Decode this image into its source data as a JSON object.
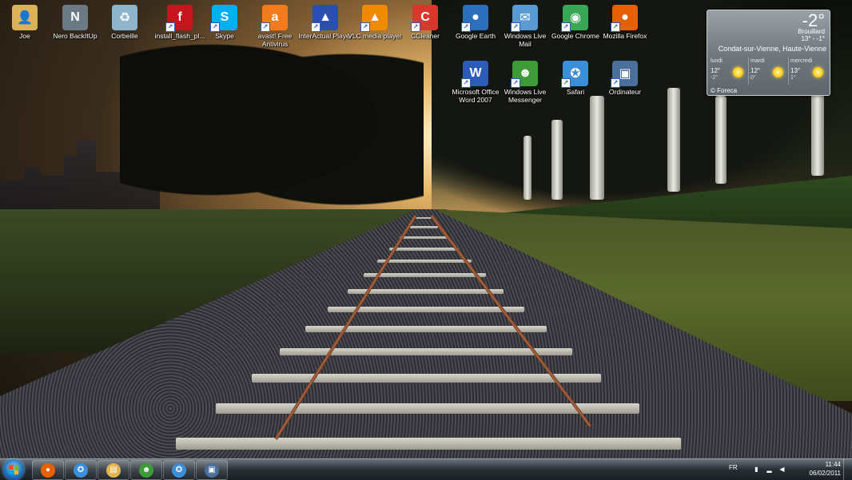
{
  "desktop": {
    "icons": [
      {
        "label": "Joe",
        "icon": "user-folder-icon",
        "color": "#d9b25a",
        "glyph": "👤"
      },
      {
        "label": "Nero BackItUp",
        "icon": "nero-backitup-icon",
        "color": "#6a7a85",
        "glyph": "N"
      },
      {
        "label": "Corbeille",
        "icon": "recycle-bin-icon",
        "color": "#8fb5cc",
        "glyph": "♻"
      },
      {
        "label": "install_flash_pl...",
        "icon": "flash-installer-icon",
        "color": "#c4161c",
        "glyph": "f"
      },
      {
        "label": "Skype",
        "icon": "skype-icon",
        "color": "#00aff0",
        "glyph": "S"
      },
      {
        "label": "avast! Free Antivirus",
        "icon": "avast-icon",
        "color": "#f27b1e",
        "glyph": "a"
      },
      {
        "label": "InterActual Player",
        "icon": "interactual-player-icon",
        "color": "#2a4fb0",
        "glyph": "▲"
      },
      {
        "label": "VLC media player",
        "icon": "vlc-icon",
        "color": "#f08a00",
        "glyph": "▲"
      },
      {
        "label": "CCleaner",
        "icon": "ccleaner-icon",
        "color": "#d8372b",
        "glyph": "C"
      },
      {
        "label": "Google Earth",
        "icon": "google-earth-icon",
        "color": "#2b6fbd",
        "glyph": "●"
      },
      {
        "label": "Windows Live Mail",
        "icon": "windows-live-mail-icon",
        "color": "#5b9bd5",
        "glyph": "✉"
      },
      {
        "label": "Google Chrome",
        "icon": "chrome-icon",
        "color": "#3aa757",
        "glyph": "◉"
      },
      {
        "label": "Mozilla Firefox",
        "icon": "firefox-icon",
        "color": "#e66000",
        "glyph": "●"
      },
      {
        "label": "Microsoft Office Word 2007",
        "icon": "word-icon",
        "color": "#2b5db8",
        "glyph": "W"
      },
      {
        "label": "Windows Live Messenger",
        "icon": "windows-live-messenger-icon",
        "color": "#3f9b3a",
        "glyph": "☻"
      },
      {
        "label": "Safari",
        "icon": "safari-icon",
        "color": "#3b8ed8",
        "glyph": "✪"
      },
      {
        "label": "Ordinateur",
        "icon": "computer-icon",
        "color": "#4a6f9b",
        "glyph": "▣"
      }
    ]
  },
  "weather": {
    "temperature": "-2°",
    "condition": "Brouillard",
    "range": "13° - -1°",
    "location": "Condat-sur-Vienne, Haute-Vienne",
    "credit": "© Foreca",
    "forecast": [
      {
        "day": "lundi",
        "high": "12°",
        "low": "-2°",
        "icon": "sun-icon"
      },
      {
        "day": "mardi",
        "high": "12°",
        "low": "0°",
        "icon": "sun-icon"
      },
      {
        "day": "mercredi",
        "high": "13°",
        "low": "1°",
        "icon": "sun-icon"
      }
    ]
  },
  "taskbar": {
    "pinned": [
      {
        "name": "firefox",
        "icon": "firefox-icon",
        "color": "#e66000",
        "glyph": "●"
      },
      {
        "name": "safari",
        "icon": "safari-icon",
        "color": "#3b8ed8",
        "glyph": "✪"
      },
      {
        "name": "explorer",
        "icon": "folder-icon",
        "color": "#e2b64c",
        "glyph": "▤"
      },
      {
        "name": "messenger",
        "icon": "windows-live-messenger-icon",
        "color": "#3f9b3a",
        "glyph": "☻"
      },
      {
        "name": "safari-2",
        "icon": "safari-icon",
        "color": "#3b8ed8",
        "glyph": "✪"
      },
      {
        "name": "screen",
        "icon": "screen-icon",
        "color": "#4a6f9b",
        "glyph": "▣"
      }
    ],
    "tray": {
      "language": "FR",
      "time": "11:44",
      "date": "06/02/2011"
    }
  }
}
